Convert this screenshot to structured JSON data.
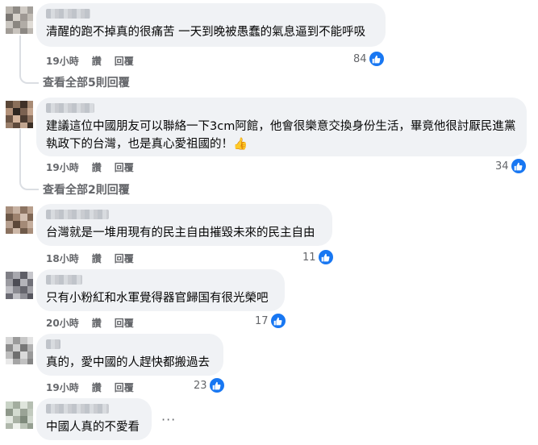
{
  "comments": [
    {
      "text": "清醒的跑不掉真的很痛苦 一天到晚被愚蠢的氣息逼到不能呼吸",
      "time": "19小時",
      "like_label": "讚",
      "reply_label": "回覆",
      "reactions": "84",
      "view_replies": "查看全部5則回覆"
    },
    {
      "text": "建議這位中國朋友可以聯絡一下3cm阿館，他會很樂意交換身份生活，畢竟他很討厭民進黨執政下的台灣，也是真心愛祖國的！👍",
      "time": "19小時",
      "like_label": "讚",
      "reply_label": "回覆",
      "reactions": "34",
      "view_replies": "查看全部2則回覆"
    },
    {
      "text": "台灣就是一堆用現有的民主自由摧毀未來的民主自由",
      "time": "18小時",
      "like_label": "讚",
      "reply_label": "回覆",
      "reactions": "11"
    },
    {
      "text": "只有小粉紅和水軍覺得器官歸国有很光榮吧",
      "time": "20小時",
      "like_label": "讚",
      "reply_label": "回覆",
      "reactions": "17"
    },
    {
      "text": "真的，愛中國的人趕快都搬過去",
      "time": "19小時",
      "like_label": "讚",
      "reply_label": "回覆",
      "reactions": "23"
    },
    {
      "text": "中國人真的不愛看",
      "more": "···"
    }
  ],
  "colors": {
    "bubble": "#f0f2f5",
    "meta": "#65676b",
    "like": "#1877f2",
    "text": "#050505"
  }
}
